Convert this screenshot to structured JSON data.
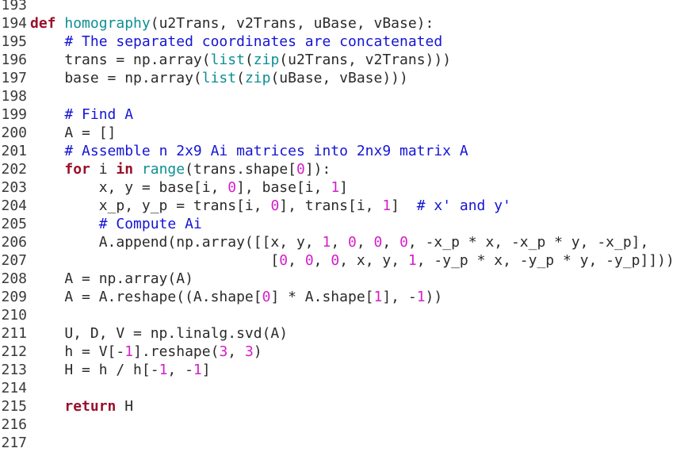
{
  "colors": {
    "background": "#ffffff",
    "keyword": "#9b0f2a",
    "function": "#0c8f94",
    "comment": "#1515d6",
    "number": "#d420c8",
    "text": "#2a2a2a"
  },
  "lines": [
    {
      "num": "193",
      "tokens": []
    },
    {
      "num": "194",
      "tokens": [
        {
          "t": "kw",
          "v": "def"
        },
        {
          "t": "plain",
          "v": " "
        },
        {
          "t": "fn",
          "v": "homography"
        },
        {
          "t": "plain",
          "v": "(u2Trans, v2Trans, uBase, vBase):"
        }
      ]
    },
    {
      "num": "195",
      "tokens": [
        {
          "t": "plain",
          "v": "    "
        },
        {
          "t": "cm",
          "v": "# The separated coordinates are concatenated"
        }
      ]
    },
    {
      "num": "196",
      "tokens": [
        {
          "t": "plain",
          "v": "    trans = np.array("
        },
        {
          "t": "bi",
          "v": "list"
        },
        {
          "t": "plain",
          "v": "("
        },
        {
          "t": "bi",
          "v": "zip"
        },
        {
          "t": "plain",
          "v": "(u2Trans, v2Trans)))"
        }
      ]
    },
    {
      "num": "197",
      "tokens": [
        {
          "t": "plain",
          "v": "    base = np.array("
        },
        {
          "t": "bi",
          "v": "list"
        },
        {
          "t": "plain",
          "v": "("
        },
        {
          "t": "bi",
          "v": "zip"
        },
        {
          "t": "plain",
          "v": "(uBase, vBase)))"
        }
      ]
    },
    {
      "num": "198",
      "tokens": []
    },
    {
      "num": "199",
      "tokens": [
        {
          "t": "plain",
          "v": "    "
        },
        {
          "t": "cm",
          "v": "# Find A"
        }
      ]
    },
    {
      "num": "200",
      "tokens": [
        {
          "t": "plain",
          "v": "    A = []"
        }
      ]
    },
    {
      "num": "201",
      "tokens": [
        {
          "t": "plain",
          "v": "    "
        },
        {
          "t": "cm",
          "v": "# Assemble n 2x9 Ai matrices into 2nx9 matrix A"
        }
      ]
    },
    {
      "num": "202",
      "tokens": [
        {
          "t": "plain",
          "v": "    "
        },
        {
          "t": "kw",
          "v": "for"
        },
        {
          "t": "plain",
          "v": " i "
        },
        {
          "t": "kw",
          "v": "in"
        },
        {
          "t": "plain",
          "v": " "
        },
        {
          "t": "bi",
          "v": "range"
        },
        {
          "t": "plain",
          "v": "(trans.shape["
        },
        {
          "t": "num",
          "v": "0"
        },
        {
          "t": "plain",
          "v": "]):"
        }
      ]
    },
    {
      "num": "203",
      "tokens": [
        {
          "t": "plain",
          "v": "        x, y = base[i, "
        },
        {
          "t": "num",
          "v": "0"
        },
        {
          "t": "plain",
          "v": "], base[i, "
        },
        {
          "t": "num",
          "v": "1"
        },
        {
          "t": "plain",
          "v": "]"
        }
      ]
    },
    {
      "num": "204",
      "tokens": [
        {
          "t": "plain",
          "v": "        x_p, y_p = trans[i, "
        },
        {
          "t": "num",
          "v": "0"
        },
        {
          "t": "plain",
          "v": "], trans[i, "
        },
        {
          "t": "num",
          "v": "1"
        },
        {
          "t": "plain",
          "v": "]  "
        },
        {
          "t": "cm",
          "v": "# x' and y'"
        }
      ]
    },
    {
      "num": "205",
      "tokens": [
        {
          "t": "plain",
          "v": "        "
        },
        {
          "t": "cm",
          "v": "# Compute Ai"
        }
      ]
    },
    {
      "num": "206",
      "tokens": [
        {
          "t": "plain",
          "v": "        A.append(np.array([[x, y, "
        },
        {
          "t": "num",
          "v": "1"
        },
        {
          "t": "plain",
          "v": ", "
        },
        {
          "t": "num",
          "v": "0"
        },
        {
          "t": "plain",
          "v": ", "
        },
        {
          "t": "num",
          "v": "0"
        },
        {
          "t": "plain",
          "v": ", "
        },
        {
          "t": "num",
          "v": "0"
        },
        {
          "t": "plain",
          "v": ", -x_p * x, -x_p * y, -x_p],"
        }
      ]
    },
    {
      "num": "207",
      "tokens": [
        {
          "t": "plain",
          "v": "                            ["
        },
        {
          "t": "num",
          "v": "0"
        },
        {
          "t": "plain",
          "v": ", "
        },
        {
          "t": "num",
          "v": "0"
        },
        {
          "t": "plain",
          "v": ", "
        },
        {
          "t": "num",
          "v": "0"
        },
        {
          "t": "plain",
          "v": ", x, y, "
        },
        {
          "t": "num",
          "v": "1"
        },
        {
          "t": "plain",
          "v": ", -y_p * x, -y_p * y, -y_p]]))"
        }
      ]
    },
    {
      "num": "208",
      "tokens": [
        {
          "t": "plain",
          "v": "    A = np.array(A)"
        }
      ]
    },
    {
      "num": "209",
      "tokens": [
        {
          "t": "plain",
          "v": "    A = A.reshape((A.shape["
        },
        {
          "t": "num",
          "v": "0"
        },
        {
          "t": "plain",
          "v": "] * A.shape["
        },
        {
          "t": "num",
          "v": "1"
        },
        {
          "t": "plain",
          "v": "], -"
        },
        {
          "t": "num",
          "v": "1"
        },
        {
          "t": "plain",
          "v": "))"
        }
      ]
    },
    {
      "num": "210",
      "tokens": []
    },
    {
      "num": "211",
      "tokens": [
        {
          "t": "plain",
          "v": "    U, D, V = np.linalg.svd(A)"
        }
      ]
    },
    {
      "num": "212",
      "tokens": [
        {
          "t": "plain",
          "v": "    h = V[-"
        },
        {
          "t": "num",
          "v": "1"
        },
        {
          "t": "plain",
          "v": "].reshape("
        },
        {
          "t": "num",
          "v": "3"
        },
        {
          "t": "plain",
          "v": ", "
        },
        {
          "t": "num",
          "v": "3"
        },
        {
          "t": "plain",
          "v": ")"
        }
      ]
    },
    {
      "num": "213",
      "tokens": [
        {
          "t": "plain",
          "v": "    H = h / h[-"
        },
        {
          "t": "num",
          "v": "1"
        },
        {
          "t": "plain",
          "v": ", -"
        },
        {
          "t": "num",
          "v": "1"
        },
        {
          "t": "plain",
          "v": "]"
        }
      ]
    },
    {
      "num": "214",
      "tokens": []
    },
    {
      "num": "215",
      "tokens": [
        {
          "t": "plain",
          "v": "    "
        },
        {
          "t": "kw",
          "v": "return"
        },
        {
          "t": "plain",
          "v": " H"
        }
      ]
    },
    {
      "num": "216",
      "tokens": []
    },
    {
      "num": "217",
      "tokens": []
    }
  ]
}
